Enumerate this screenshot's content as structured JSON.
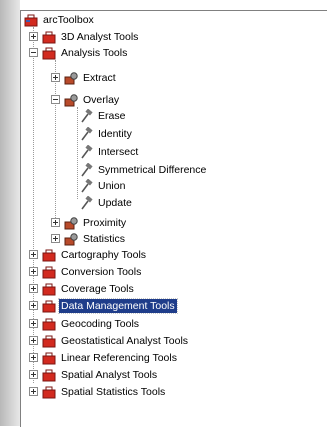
{
  "tree": {
    "root": "arcToolbox",
    "items": [
      {
        "label": "3D Analyst Tools"
      },
      {
        "label": "Analysis Tools"
      },
      {
        "label": "Extract"
      },
      {
        "label": "Overlay"
      },
      {
        "label": "Erase"
      },
      {
        "label": "Identity"
      },
      {
        "label": "Intersect"
      },
      {
        "label": "Symmetrical Difference"
      },
      {
        "label": "Union"
      },
      {
        "label": "Update"
      },
      {
        "label": "Proximity"
      },
      {
        "label": "Statistics"
      },
      {
        "label": "Cartography Tools"
      },
      {
        "label": "Conversion Tools"
      },
      {
        "label": "Coverage Tools"
      },
      {
        "label": "Data Management Tools"
      },
      {
        "label": "Geocoding Tools"
      },
      {
        "label": "Geostatistical Analyst Tools"
      },
      {
        "label": "Linear Referencing Tools"
      },
      {
        "label": "Spatial Analyst Tools"
      },
      {
        "label": "Spatial Statistics Tools"
      }
    ],
    "selected_label": "Data Management Tools"
  },
  "colors": {
    "selection_bg": "#1f3d8a",
    "toolbox_red": "#d22a1f",
    "tool_icon": "#555555"
  },
  "icons": {
    "root": "arctoolbox-icon",
    "toolbox": "red-toolbox-icon",
    "toolset": "toolset-icon",
    "tool": "hammer-tool-icon"
  }
}
